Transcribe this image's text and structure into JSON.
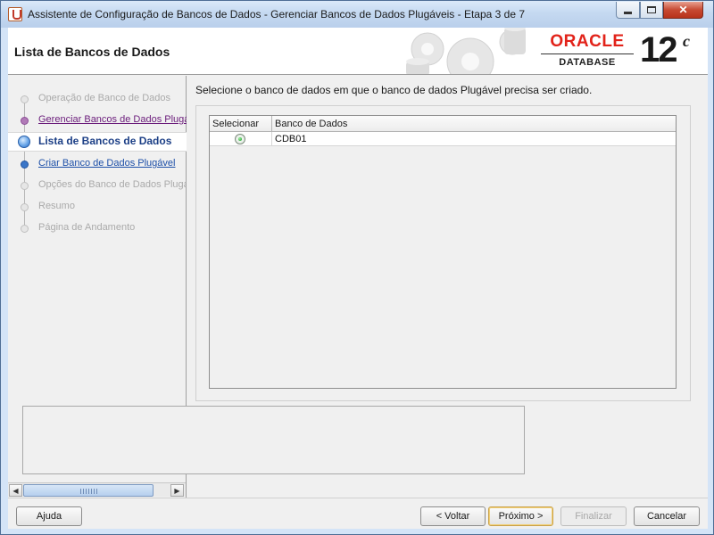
{
  "window": {
    "title": "Assistente de Configuração de Bancos de Dados - Gerenciar Bancos de Dados Plugáveis - Etapa 3 de 7"
  },
  "banner": {
    "page_title": "Lista de Bancos de Dados",
    "logo_brand": "ORACLE",
    "logo_product": "DATABASE",
    "logo_version": "12",
    "logo_version_suffix": "c"
  },
  "steps": [
    {
      "label": "Operação de Banco de Dados",
      "state": "disabled"
    },
    {
      "label": "Gerenciar Bancos de Dados Plugáveis",
      "state": "visited"
    },
    {
      "label": "Lista de Bancos de Dados",
      "state": "current"
    },
    {
      "label": "Criar Banco de Dados Plugável",
      "state": "link"
    },
    {
      "label": "Opções do Banco de Dados Plugável",
      "state": "disabled"
    },
    {
      "label": "Resumo",
      "state": "disabled"
    },
    {
      "label": "Página de Andamento",
      "state": "disabled"
    }
  ],
  "main": {
    "instruction": "Selecione o banco de dados em que o banco de dados Plugável precisa ser criado.",
    "table": {
      "columns": [
        "Selecionar",
        "Banco de Dados"
      ],
      "rows": [
        {
          "selected": true,
          "database": "CDB01"
        }
      ]
    }
  },
  "buttons": {
    "help": "Ajuda",
    "back": "< Voltar",
    "next": "Próximo >",
    "finish": "Finalizar",
    "cancel": "Cancelar"
  },
  "colors": {
    "oracle_red": "#e2231a",
    "current_step": "#1c3f86",
    "visited_step": "#6a1b7a",
    "link_step": "#1c4fa8"
  }
}
